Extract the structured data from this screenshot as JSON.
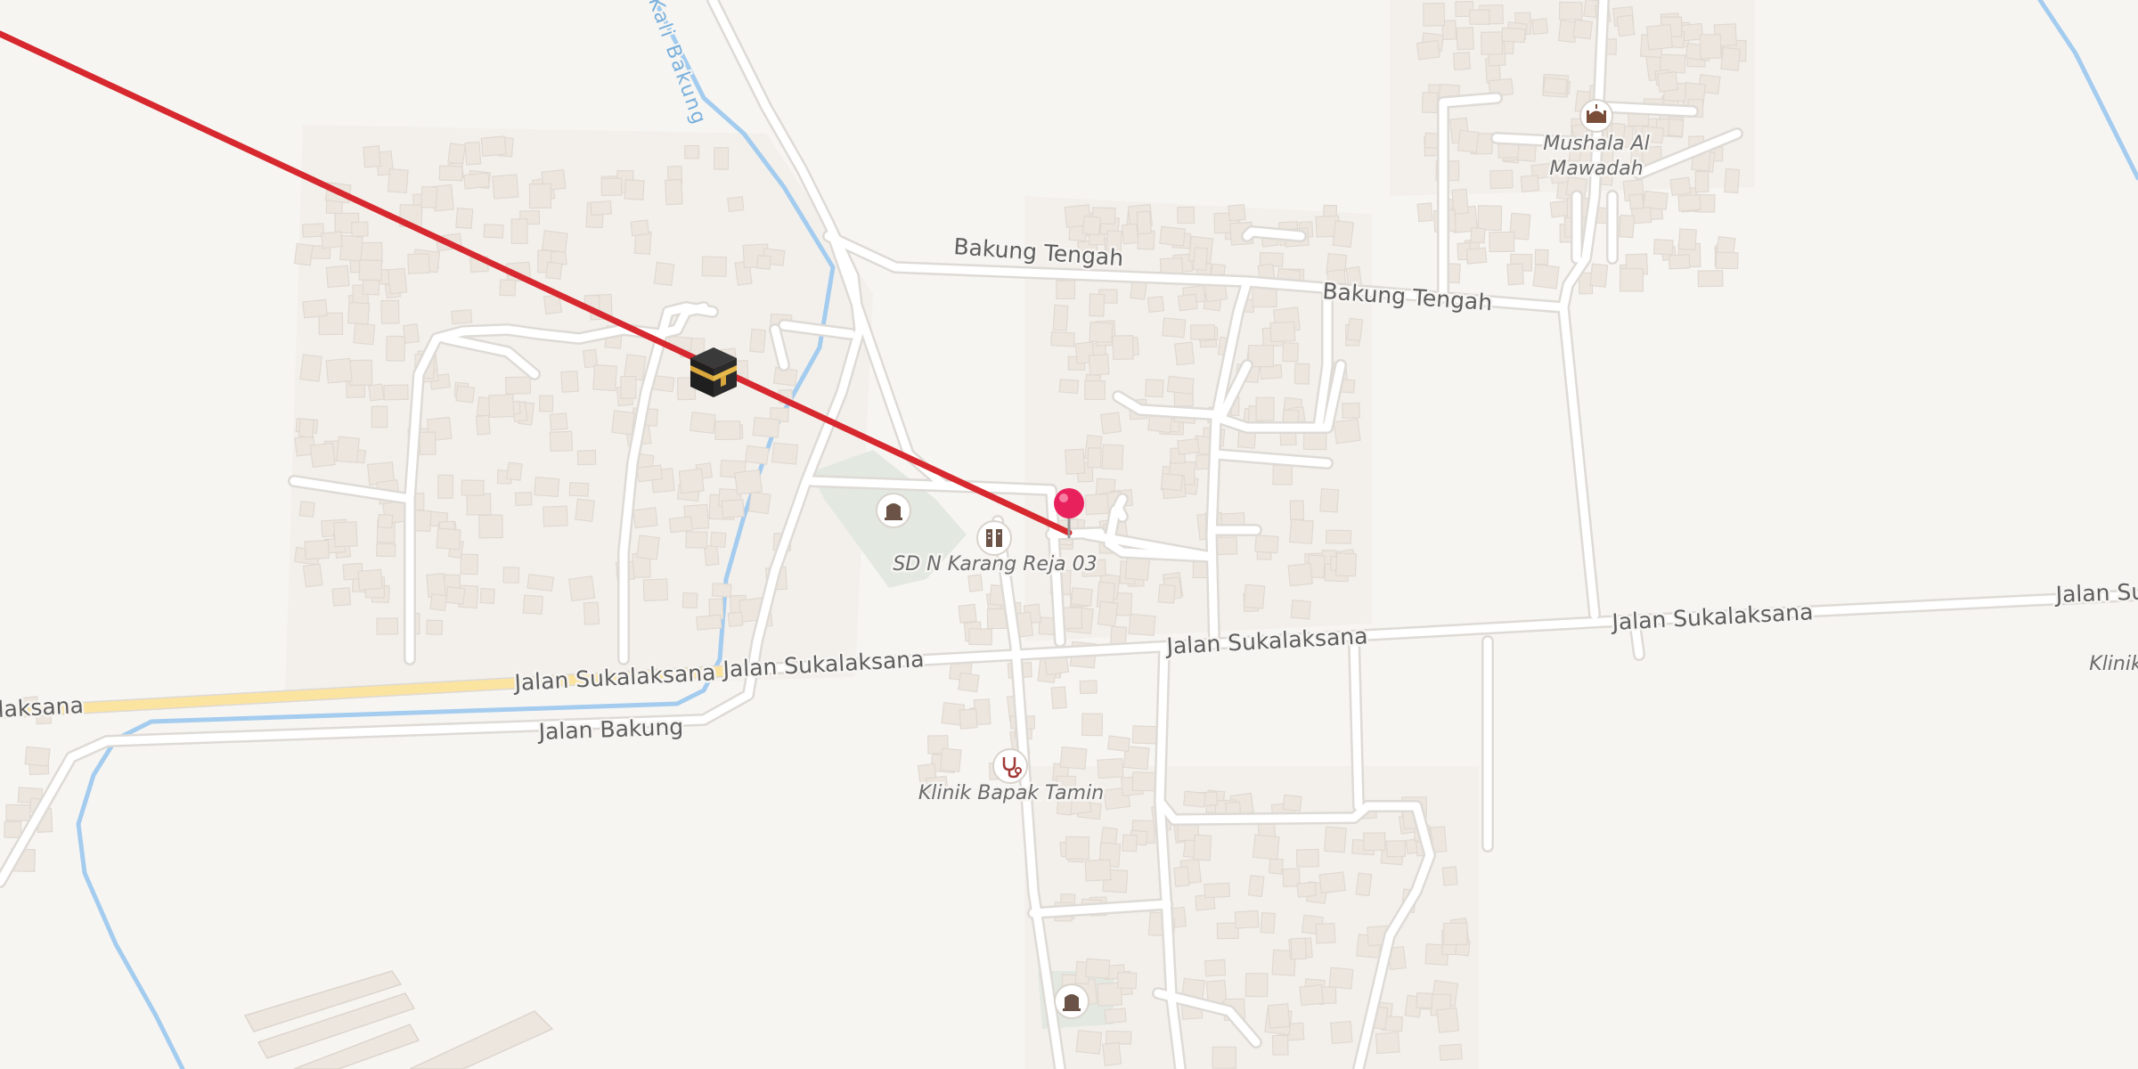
{
  "map": {
    "roads": {
      "bakung_tengah_1": "Bakung Tengah",
      "bakung_tengah_2": "Bakung Tengah",
      "sukalaksana_1": "laksana",
      "sukalaksana_2": "Jalan Sukalaksana",
      "sukalaksana_3": "Jalan Sukalaksana",
      "sukalaksana_4": "Jalan Sukalaksana",
      "sukalaksana_5": "Jalan Sukalaksana",
      "sukalaksana_6": "Jalan Su",
      "jalan_bakung": "Jalan Bakung"
    },
    "waterway": "Kali Bakung",
    "pois": {
      "mushala_line1": "Mushala Al",
      "mushala_line2": "Mawadah",
      "school": "SD N Karang Reja 03",
      "clinic": "Klinik Bapak Tamin",
      "clinic_edge": "Klinik"
    },
    "icons": {
      "kaaba": "kaaba-icon",
      "pin": "map-pin-icon",
      "mosque": "mosque-icon",
      "cemetery": "cemetery-icon",
      "school": "school-icon",
      "clinic": "stethoscope-icon"
    },
    "colors": {
      "background": "#f7f5f2",
      "road": "#ffffff",
      "primary_road": "#fbe3a0",
      "water": "#a4ccef",
      "park": "#e3e8e1",
      "building": "#ece6df",
      "qibla_line": "#d6282e",
      "pin": "#e8215d"
    }
  }
}
